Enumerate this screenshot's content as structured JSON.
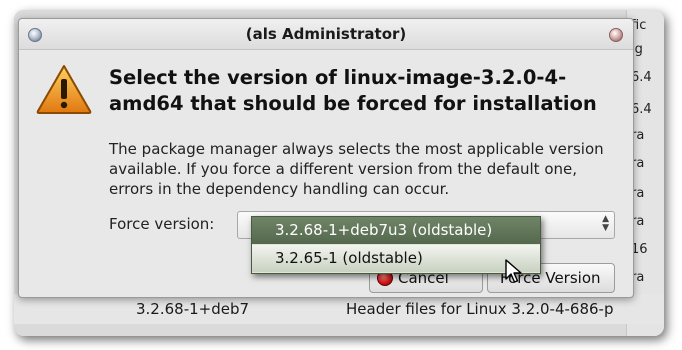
{
  "dialog": {
    "title": "(als Administrator)",
    "heading": "Select the version of linux-image-3.2.0-4-amd64 that should be forced for installation",
    "body": "The package manager always selects the most applicable version available. If you force a different version from the default one, errors in the dependency handling can occur.",
    "force_version_label": "Force version:",
    "dropdown": {
      "selected": "3.2.68-1+deb7u3 (oldstable)",
      "options": [
        "3.2.68-1+deb7u3 (oldstable)",
        "3.2.65-1 (oldstable)"
      ]
    },
    "buttons": {
      "cancel": "Cancel",
      "force": "Force Version"
    }
  },
  "background": {
    "row": {
      "version": "3.2.68-1+deb7",
      "description": "Header files for Linux 3.2.0-4-686-p"
    },
    "right_column_fragments": [
      "fic",
      "ig",
      "6.4",
      "6.4",
      "ra",
      "ra",
      "ra",
      "ra",
      "16",
      "ra"
    ]
  },
  "colors": {
    "dropdown_selected_bg": "#5f7358",
    "cancel_icon": "#d81818",
    "warning_icon": "#f0a020"
  },
  "icons": {
    "warning": "warning-icon",
    "cancel": "cancel-icon",
    "combo": "spin-arrows-icon",
    "cursor": "mouse-pointer-icon"
  }
}
